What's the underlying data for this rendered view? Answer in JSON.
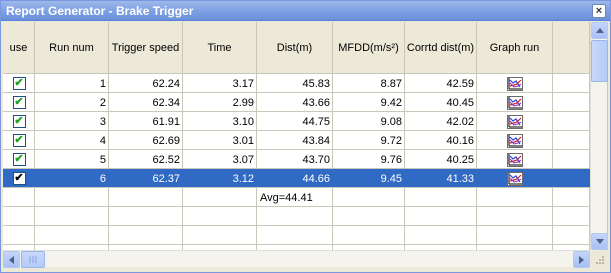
{
  "window": {
    "title": "Report Generator - Brake Trigger",
    "close_glyph": "×"
  },
  "columns": [
    {
      "key": "use",
      "label": "use"
    },
    {
      "key": "run",
      "label": "Run num"
    },
    {
      "key": "trigger",
      "label": "Trigger speed"
    },
    {
      "key": "time",
      "label": "Time"
    },
    {
      "key": "dist",
      "label": "Dist(m)"
    },
    {
      "key": "mfdd",
      "label": "MFDD(m/s²)"
    },
    {
      "key": "corr",
      "label": "Corrtd dist(m)"
    },
    {
      "key": "graph",
      "label": "Graph run"
    }
  ],
  "rows": [
    {
      "use": true,
      "run": "1",
      "trigger": "62.24",
      "time": "3.17",
      "dist": "45.83",
      "mfdd": "8.87",
      "corr": "42.59",
      "graph_icon": "graph-icon"
    },
    {
      "use": true,
      "run": "2",
      "trigger": "62.34",
      "time": "2.99",
      "dist": "43.66",
      "mfdd": "9.42",
      "corr": "40.45",
      "graph_icon": "graph-icon"
    },
    {
      "use": true,
      "run": "3",
      "trigger": "61.91",
      "time": "3.10",
      "dist": "44.75",
      "mfdd": "9.08",
      "corr": "42.02",
      "graph_icon": "graph-icon"
    },
    {
      "use": true,
      "run": "4",
      "trigger": "62.69",
      "time": "3.01",
      "dist": "43.84",
      "mfdd": "9.72",
      "corr": "40.16",
      "graph_icon": "graph-icon"
    },
    {
      "use": true,
      "run": "5",
      "trigger": "62.52",
      "time": "3.07",
      "dist": "43.70",
      "mfdd": "9.76",
      "corr": "40.25",
      "graph_icon": "graph-icon"
    },
    {
      "use": true,
      "run": "6",
      "trigger": "62.37",
      "time": "3.12",
      "dist": "44.66",
      "mfdd": "9.45",
      "corr": "41.33",
      "graph_icon": "graph-icon",
      "selected": true
    }
  ],
  "summary": {
    "avg_label": "Avg=44.41"
  },
  "colors": {
    "titlebar": "#7fa2e4",
    "selection": "#316ac5",
    "grid_lines": "#c9c7ba",
    "checkmark": "#21a121"
  }
}
